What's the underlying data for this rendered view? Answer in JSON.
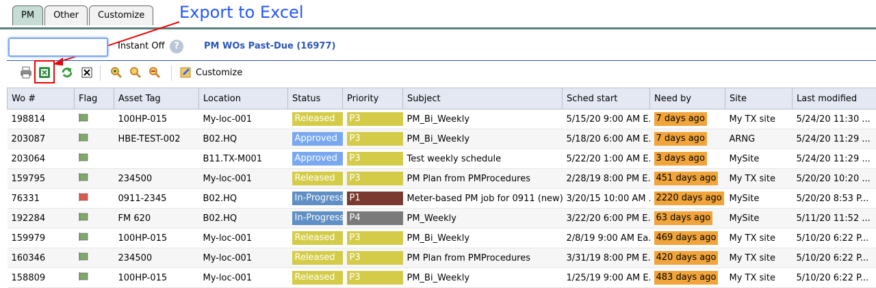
{
  "tabs": [
    {
      "label": "PM",
      "active": true
    },
    {
      "label": "Other",
      "active": false
    },
    {
      "label": "Customize",
      "active": false
    }
  ],
  "annotation": {
    "text": "Export to Excel",
    "color": "#2255ff"
  },
  "search": {
    "value": "",
    "placeholder": ""
  },
  "instant_label": "Instant Off",
  "help_glyph": "?",
  "pm_title": "PM WOs Past-Due (16977)",
  "toolbar": {
    "icons": [
      "print-icon",
      "export-excel-icon",
      "refresh-icon",
      "clear-icon",
      "zoom-in-icon",
      "zoom-icon",
      "zoom-out-icon",
      "customize-icon"
    ],
    "customize_label": "Customize"
  },
  "columns": [
    "Wo #",
    "Flag",
    "Asset Tag",
    "Location",
    "Status",
    "Priority",
    "Subject",
    "Sched start",
    "Need by",
    "Site",
    "Last modified"
  ],
  "status_colors": {
    "Released": "#d4cc48",
    "Approved": "#7aa8f0",
    "In-Progress": "#5f8fc4"
  },
  "priority_colors": {
    "P3": "#d4cc48",
    "P1": "#7a3a32",
    "P4": "#7a7a7a"
  },
  "flag_colors": {
    "green": "#7fa86a",
    "red": "#e05a4a"
  },
  "rows": [
    {
      "wo": "198814",
      "flag": "green",
      "asset": "100HP-015",
      "location": "My-loc-001",
      "status": "Released",
      "priority": "P3",
      "subject": "PM_Bi_Weekly",
      "sched": "5/15/20 9:00 AM E...",
      "need": "7 days ago",
      "site": "My TX site",
      "modified": "5/24/20 11:30 ..."
    },
    {
      "wo": "203087",
      "flag": "green",
      "asset": "HBE-TEST-002",
      "location": "B02.HQ",
      "status": "Approved",
      "priority": "P3",
      "subject": "PM_Bi_Weekly",
      "sched": "5/18/20 6:00 AM E...",
      "need": "7 days ago",
      "site": "ARNG",
      "modified": "5/24/20 11:29 ..."
    },
    {
      "wo": "203064",
      "flag": "green",
      "asset": "",
      "location": "B11.TX-M001",
      "status": "Approved",
      "priority": "P3",
      "subject": "Test weekly schedule",
      "sched": "5/22/20 1:00 AM E...",
      "need": "3 days ago",
      "site": "MySite",
      "modified": "5/24/20 11:29 ..."
    },
    {
      "wo": "159795",
      "flag": "green",
      "asset": "234500",
      "location": "My-loc-001",
      "status": "Released",
      "priority": "P3",
      "subject": "PM Plan from PMProcedures",
      "sched": "2/28/19 8:00 PM E...",
      "need": "451 days ago",
      "site": "My TX site",
      "modified": "5/20/20 10:20 ..."
    },
    {
      "wo": "76331",
      "flag": "red",
      "asset": "0911-2345",
      "location": "B02.HQ",
      "status": "In-Progress",
      "priority": "P1",
      "subject": "Meter-based PM job for 0911 (new)",
      "sched": "3/20/15 10:00 AM ...",
      "need": "2220 days ago",
      "site": "MySite",
      "modified": "5/20/20 8:53 P..."
    },
    {
      "wo": "192284",
      "flag": "green",
      "asset": "FM 620",
      "location": "B02.HQ",
      "status": "In-Progress",
      "priority": "P4",
      "subject": "PM_Weekly",
      "sched": "3/22/20 6:00 PM E...",
      "need": "63 days ago",
      "site": "MySite",
      "modified": "5/11/20 11:52 ..."
    },
    {
      "wo": "159979",
      "flag": "green",
      "asset": "100HP-015",
      "location": "My-loc-001",
      "status": "Released",
      "priority": "P3",
      "subject": "PM_Bi_Weekly",
      "sched": "2/8/19 9:00 AM Ea...",
      "need": "469 days ago",
      "site": "My TX site",
      "modified": "5/10/20 6:22 P..."
    },
    {
      "wo": "160346",
      "flag": "green",
      "asset": "234500",
      "location": "My-loc-001",
      "status": "Released",
      "priority": "P3",
      "subject": "PM Plan from PMProcedures",
      "sched": "3/31/19 8:00 PM E...",
      "need": "420 days ago",
      "site": "My TX site",
      "modified": "5/10/20 6:22 P..."
    },
    {
      "wo": "158809",
      "flag": "green",
      "asset": "100HP-015",
      "location": "My-loc-001",
      "status": "Released",
      "priority": "P3",
      "subject": "PM_Bi_Weekly",
      "sched": "1/25/19 9:00 AM E...",
      "need": "483 days ago",
      "site": "My TX site",
      "modified": "5/10/20 6:22 P..."
    }
  ]
}
